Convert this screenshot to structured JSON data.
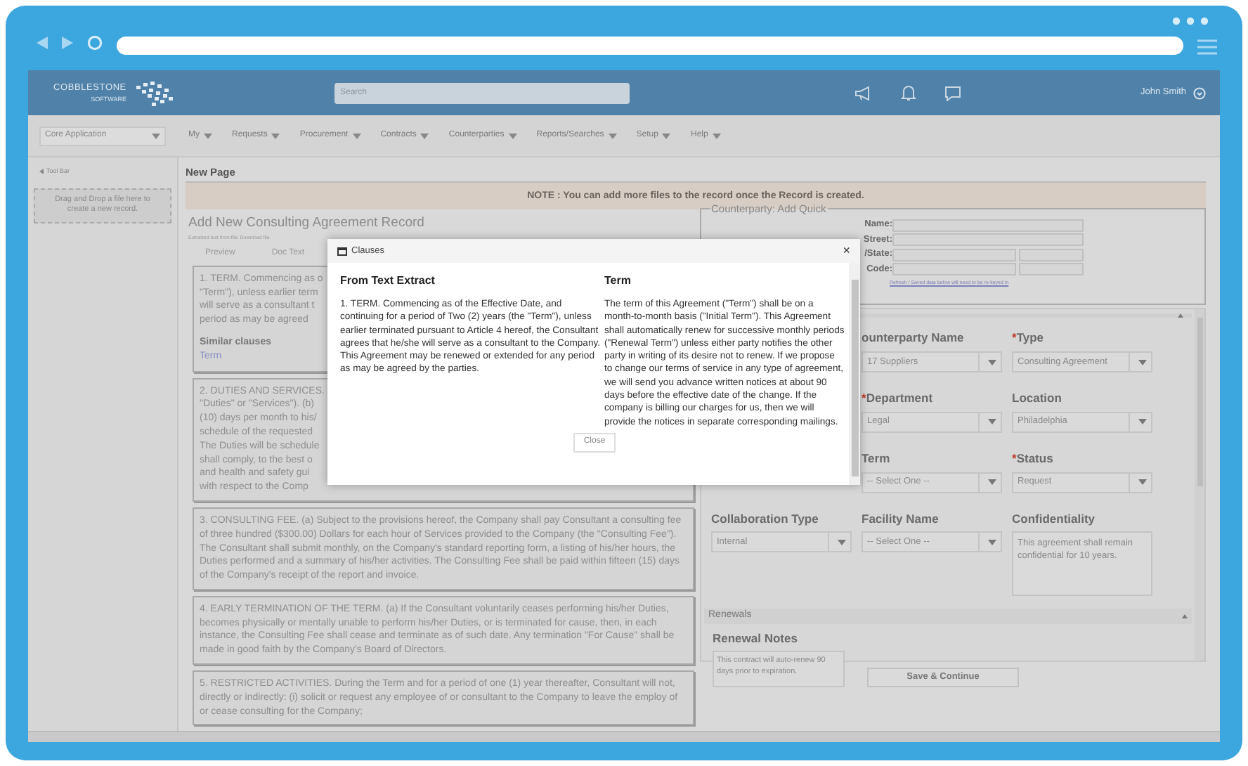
{
  "header": {
    "logo": {
      "name": "COBBLESTONE",
      "tagline": "SOFTWARE"
    },
    "search": {
      "placeholder": "Search"
    },
    "user": "John Smith"
  },
  "nav": {
    "app_select": "Core Application",
    "menus": [
      "My",
      "Requests",
      "Procurement",
      "Contracts",
      "Counterparties",
      "Reports/Searches",
      "Setup",
      "Help"
    ]
  },
  "sidebar": {
    "toggle": "Tool Bar",
    "dropzone": "Drag and Drop a file here to create a new record."
  },
  "page": {
    "title": "New Page",
    "note": "NOTE : You can add more files to the record once the Record is created.",
    "record_title": "Add New Consulting Agreement Record",
    "subtitle": "Extracted text from file: Download file",
    "tabs": [
      "Preview",
      "Doc Text"
    ]
  },
  "clauses": [
    {
      "lines": [
        "1. TERM. Commencing as o",
        "\"Term\"), unless earlier term",
        "will serve as a consultant t",
        "period as may be agreed"
      ],
      "similar": {
        "heading": "Similar clauses",
        "link": "Term"
      }
    },
    {
      "lines": [
        "2. DUTIES AND SERVICES.",
        "\"Duties\" or \"Services\"). (b)",
        "(10) days per month to his/",
        "schedule of the requested",
        "The Duties will be schedule",
        "shall comply, to the best o",
        "and health and safety gui",
        "with respect to the Comp"
      ]
    },
    {
      "text": "3. CONSULTING FEE. (a) Subject to the provisions hereof, the Company shall pay Consultant a consulting fee of three hundred ($300.00) Dollars for each hour of Services provided to the Company (the \"Consulting Fee\"). The Consultant shall submit monthly, on the Company's standard reporting form, a listing of his/her hours, the Duties performed and a summary of his/her activities. The Consulting Fee shall be paid within fifteen (15) days of the Company's receipt of the report and invoice."
    },
    {
      "text": "4. EARLY TERMINATION OF THE TERM. (a) If the Consultant voluntarily ceases performing his/her Duties, becomes physically or mentally unable to perform his/her Duties, or is terminated for cause, then, in each instance, the Consulting Fee shall cease and terminate as of such date. Any termination \"For Cause\" shall be made in good faith by the Company's Board of Directors."
    },
    {
      "text": "5. RESTRICTED ACTIVITIES. During the Term and for a period of one (1) year thereafter, Consultant will not, directly or indirectly: (i) solicit or request any employee of or consultant to the Company to leave the employ of or cease consulting for the Company;"
    }
  ],
  "counterparty": {
    "legend": "Counterparty: Add Quick",
    "fields": [
      "Name:",
      "Street:",
      "/State:",
      "Code:"
    ],
    "link": "Refresh / Saved data below will need to be re-keyed in"
  },
  "form": {
    "fields": [
      {
        "kind": "hidden"
      },
      {
        "kind": "select",
        "label": "ounterparty Name",
        "value": "17 Suppliers"
      },
      {
        "kind": "select",
        "asterisk": "*",
        "label": "Type",
        "value": "Consulting Agreement"
      },
      {
        "kind": "hidden"
      },
      {
        "kind": "select",
        "asterisk": "*",
        "label": "Department",
        "value": "Legal"
      },
      {
        "kind": "select",
        "label": "Location",
        "value": "Philadelphia"
      },
      {
        "kind": "hidden"
      },
      {
        "kind": "select",
        "label": "Term",
        "value": "-- Select One --"
      },
      {
        "kind": "select",
        "asterisk": "*",
        "label": "Status",
        "value": "Request"
      },
      {
        "kind": "select",
        "label": "Collaboration Type",
        "value": "Internal"
      },
      {
        "kind": "select",
        "label": "Facility Name",
        "value": "-- Select One --"
      },
      {
        "kind": "textarea",
        "label": "Confidentiality",
        "value": "This agreement shall remain confidential for 10 years."
      }
    ],
    "renewals": {
      "title": "Renewals",
      "label": "Renewal Notes",
      "value": "This contract will auto-renew 90 days prior to expiration."
    },
    "save": "Save & Continue"
  },
  "modal": {
    "title": "Clauses",
    "close_icon": "×",
    "columns": [
      {
        "heading": "From Text Extract",
        "text": "1. TERM. Commencing as of the Effective Date, and continuing for a period of Two (2) years (the \"Term\"), unless earlier terminated pursuant to Article 4 hereof, the Consultant agrees that he/she will serve as a consultant to the Company. This Agreement may be renewed or extended for any period as may be agreed by the parties."
      },
      {
        "heading": "Term",
        "text": "The term of this Agreement (\"Term\") shall be on a month-to-month basis (\"Initial Term\"). This Agreement shall automatically renew for successive monthly periods (\"Renewal Term\") unless either party notifies the other party in writing of its desire not to renew. If we propose to change our terms of service in any type of agreement, we will send you advance written notices at about 90 days before the effective date of the change. If the company is billing our charges for us, then we will provide the notices in separate corresponding mailings."
      }
    ],
    "close_button": "Close"
  }
}
